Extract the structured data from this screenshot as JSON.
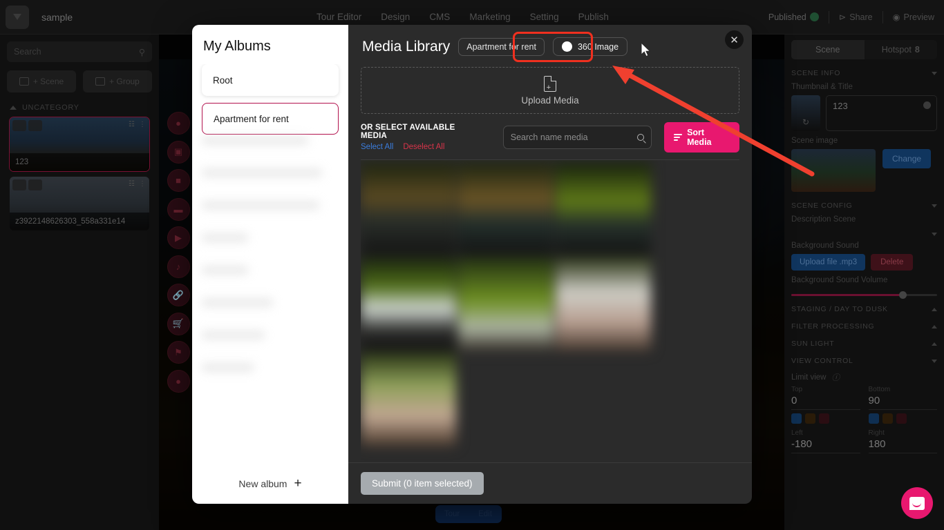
{
  "topbar": {
    "project_name": "sample",
    "nav": [
      "Tour Editor",
      "Design",
      "CMS",
      "Marketing",
      "Setting",
      "Publish"
    ],
    "published_label": "Published",
    "share_label": "Share",
    "preview_label": "Preview"
  },
  "left_sidebar": {
    "search_placeholder": "Search",
    "add_scene_label": "+ Scene",
    "add_group_label": "+ Group",
    "category_label": "UNCATEGORY",
    "scenes": [
      {
        "title": "123"
      },
      {
        "title": "z3922148626303_558a331e14"
      }
    ]
  },
  "right_sidebar": {
    "tab_scene": "Scene",
    "tab_hotspot": "Hotspot",
    "hotspot_count": "8",
    "scene_info_label": "SCENE INFO",
    "thumbnail_title_label": "Thumbnail & Title",
    "scene_title_value": "123",
    "scene_image_label": "Scene image",
    "change_label": "Change",
    "scene_config_label": "SCENE CONFIG",
    "description_scene_label": "Description Scene",
    "background_sound_label": "Background Sound",
    "upload_mp3_label": "Upload file .mp3",
    "delete_label": "Delete",
    "bg_sound_volume_label": "Background Sound Volume",
    "staging_label": "STAGING / DAY TO DUSK",
    "filter_label": "FILTER PROCESSING",
    "sunlight_label": "SUN LIGHT",
    "view_control_label": "VIEW CONTROL",
    "limit_view_label": "Limit view",
    "view_fields": [
      {
        "label": "Top",
        "value": "0"
      },
      {
        "label": "Bottom",
        "value": "90"
      },
      {
        "label": "Left",
        "value": "-180"
      },
      {
        "label": "Right",
        "value": "180"
      }
    ]
  },
  "bottom_toggle": {
    "tour": "Tour",
    "edit": "Edit"
  },
  "modal": {
    "albums": {
      "title": "My Albums",
      "items": [
        {
          "label": "Root",
          "active": false
        },
        {
          "label": "Apartment for rent",
          "active": true
        }
      ],
      "new_album_label": "New album",
      "new_album_icon": "plus-icon"
    },
    "media": {
      "title": "Media Library",
      "album_chip": "Apartment for rent",
      "toggle_360_label": "360 Image",
      "close_icon": "close-icon",
      "upload_label": "Upload Media",
      "upload_icon": "file-plus-icon",
      "or_select_label": "OR SELECT AVAILABLE MEDIA",
      "select_all_label": "Select All",
      "deselect_all_label": "Deselect All",
      "search_placeholder": "Search name media",
      "search_value": "",
      "search_icon": "search-icon",
      "sort_label": "Sort Media",
      "sort_icon": "sort-icon",
      "submit_label": "Submit (0 item selected)"
    }
  },
  "annotation": {
    "highlight_color": "#f0301f",
    "arrow_from": "1175,252",
    "arrow_to": "890,96"
  },
  "colors": {
    "accent_pink": "#e8186f",
    "album_active_border": "#b2104c",
    "link_blue": "#3b7ddd",
    "link_red": "#d9344a"
  }
}
